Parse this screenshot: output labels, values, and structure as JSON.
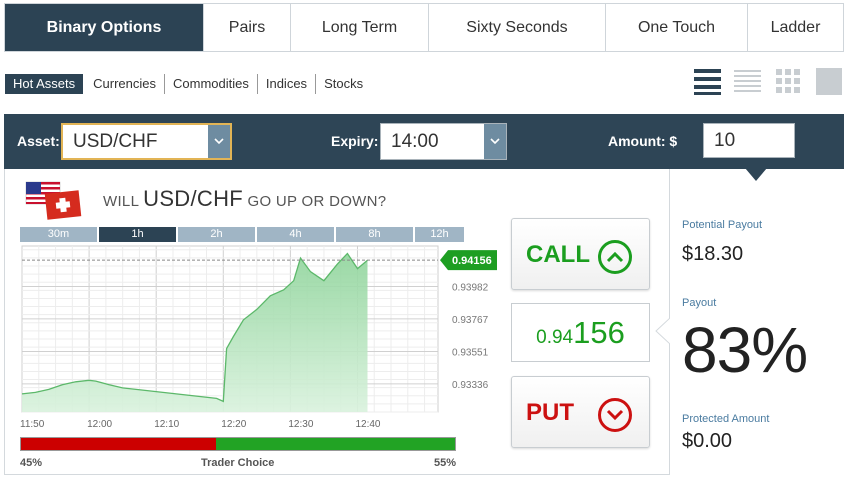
{
  "top_tabs": [
    {
      "label": "Binary Options",
      "active": true
    },
    {
      "label": "Pairs"
    },
    {
      "label": "Long Term"
    },
    {
      "label": "Sixty Seconds"
    },
    {
      "label": "One Touch"
    },
    {
      "label": "Ladder"
    }
  ],
  "sub_nav": [
    {
      "label": "Hot Assets",
      "active": true
    },
    {
      "label": "Currencies"
    },
    {
      "label": "Commodities"
    },
    {
      "label": "Indices"
    },
    {
      "label": "Stocks"
    }
  ],
  "view_icons": [
    "list-view-icon",
    "compact-list-icon",
    "grid-view-icon",
    "tile-view-icon"
  ],
  "asset_bar": {
    "asset_label": "Asset:",
    "asset_value": "USD/CHF",
    "expiry_label": "Expiry:",
    "expiry_value": "14:00",
    "amount_label": "Amount: $",
    "amount_value": "10"
  },
  "question": {
    "pre": "WILL ",
    "asset": "USD/CHF",
    "post": " GO UP OR DOWN?"
  },
  "timeframes": [
    {
      "label": "30m"
    },
    {
      "label": "1h",
      "active": true
    },
    {
      "label": "2h"
    },
    {
      "label": "4h"
    },
    {
      "label": "8h"
    },
    {
      "label": "12h"
    }
  ],
  "chart_data": {
    "type": "area",
    "current_value": 0.94156,
    "current_label": "0.94156",
    "y_ticks": [
      "0.93982",
      "0.93767",
      "0.93551",
      "0.93336"
    ],
    "y_tick_values": [
      0.93982,
      0.93767,
      0.93551,
      0.93336
    ],
    "ylim": [
      0.9315,
      0.9425
    ],
    "x_ticks": [
      "11:50",
      "12:00",
      "12:10",
      "12:20",
      "12:30",
      "12:40"
    ],
    "x_tick_values": [
      0,
      10,
      20,
      30,
      40,
      50
    ],
    "xlim": [
      0,
      62
    ],
    "series": [
      {
        "values": [
          [
            0,
            0.9327
          ],
          [
            2,
            0.9328
          ],
          [
            4,
            0.933
          ],
          [
            6,
            0.9333
          ],
          [
            8,
            0.9335
          ],
          [
            10,
            0.9336
          ],
          [
            11,
            0.93355
          ],
          [
            13,
            0.9333
          ],
          [
            15,
            0.9331
          ],
          [
            17,
            0.933
          ],
          [
            19,
            0.9329
          ],
          [
            21,
            0.9328
          ],
          [
            23,
            0.9327
          ],
          [
            25,
            0.9326
          ],
          [
            27,
            0.9325
          ],
          [
            29,
            0.9324
          ],
          [
            30,
            0.9322
          ],
          [
            30.5,
            0.9357
          ],
          [
            31.5,
            0.9365
          ],
          [
            33,
            0.9376
          ],
          [
            35,
            0.9383
          ],
          [
            37,
            0.9392
          ],
          [
            39,
            0.9396
          ],
          [
            40.5,
            0.9402
          ],
          [
            41.5,
            0.9417
          ],
          [
            43,
            0.9408
          ],
          [
            45,
            0.9402
          ],
          [
            47,
            0.9413
          ],
          [
            48.5,
            0.942
          ],
          [
            50,
            0.941
          ],
          [
            51.5,
            0.94156
          ]
        ]
      }
    ],
    "reference_line": 0.94156,
    "grid": true
  },
  "trader_choice": {
    "label": "Trader Choice",
    "put_pct_label": "45%",
    "call_pct_label": "55%",
    "put_pct": 45,
    "call_pct": 55
  },
  "buttons": {
    "call_label": "CALL",
    "put_label": "PUT"
  },
  "price": {
    "prefix": "0.94",
    "suffix": "156"
  },
  "right_panel": {
    "potential_label": "Potential Payout",
    "potential_value": "$18.30",
    "payout_label": "Payout",
    "payout_value": "83%",
    "protected_label": "Protected Amount",
    "protected_value": "$0.00"
  },
  "colors": {
    "nav_dark": "#2c4354",
    "green": "#1b9e1f",
    "red": "#cc1111",
    "label_blue": "#4a7ba0"
  }
}
